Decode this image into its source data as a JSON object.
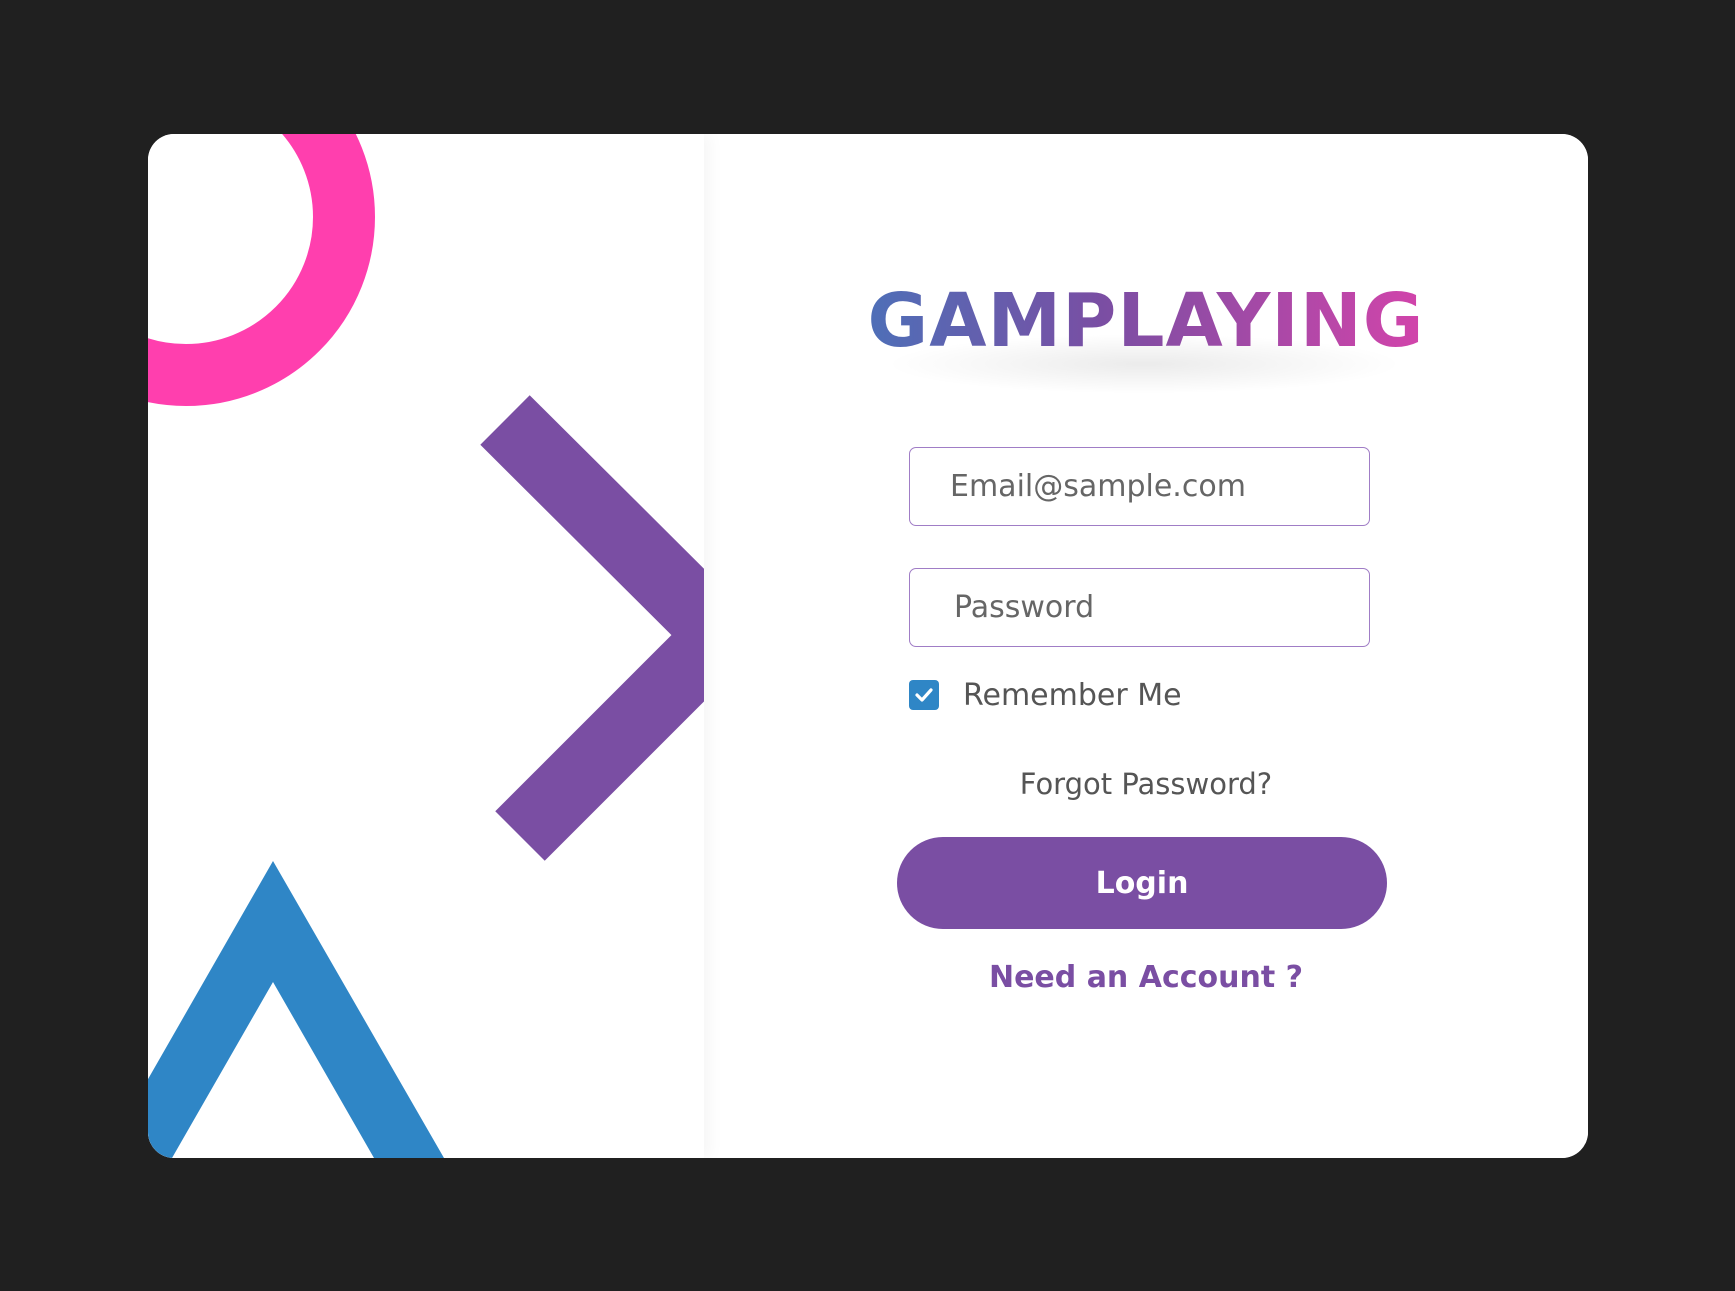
{
  "brand": {
    "name": "GAMPLAYING"
  },
  "login_form": {
    "email": {
      "placeholder": "Email@sample.com",
      "value": ""
    },
    "password": {
      "placeholder": "Password",
      "value": ""
    },
    "remember_me": {
      "label": "Remember Me",
      "checked": true
    },
    "forgot_password_label": "Forgot Password?",
    "login_button_label": "Login",
    "need_account_label": "Need an Account ?"
  },
  "decorations": {
    "icons": [
      "circle-shape",
      "chevron-right-shape",
      "triangle-shape"
    ]
  },
  "colors": {
    "background": "#202020",
    "card": "#ffffff",
    "pink": "#ff3fae",
    "purple": "#7a4ea3",
    "blue": "#2f86c6"
  }
}
